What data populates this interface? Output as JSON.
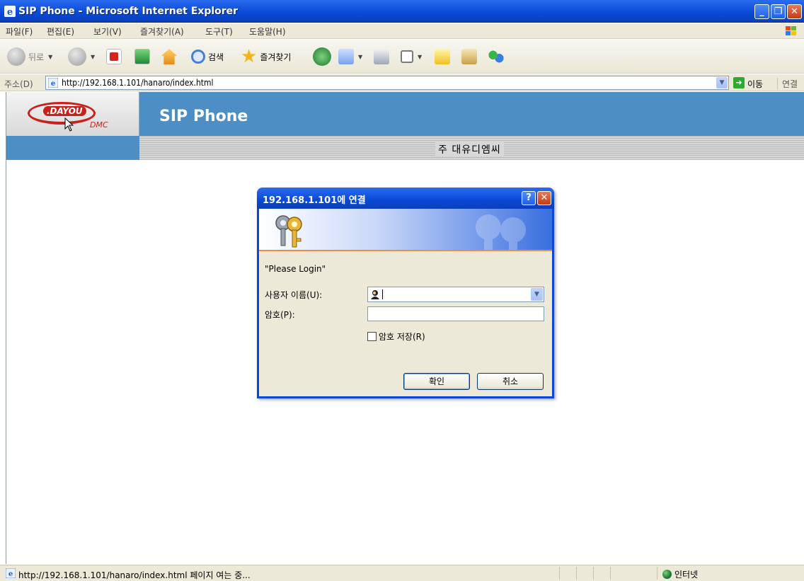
{
  "window": {
    "title": "SIP Phone - Microsoft Internet Explorer",
    "minimize_icon": "minimize-icon",
    "maximize_icon": "restore-icon",
    "close_icon": "close-icon"
  },
  "menu": {
    "items": [
      "파일(F)",
      "편집(E)",
      "보기(V)",
      "즐겨찾기(A)",
      "도구(T)",
      "도움말(H)"
    ]
  },
  "toolbar": {
    "back_label": "뒤로",
    "search_label": "검색",
    "favorites_label": "즐겨찾기"
  },
  "address": {
    "label": "주소(D)",
    "url": "http://192.168.1.101/hanaro/index.html",
    "go_label": "이동",
    "links_label": "연결"
  },
  "page": {
    "logo_text": ".DAYOU",
    "logo_sub": "DMC",
    "site_title": "SIP Phone",
    "company": "주 대유디엠씨",
    "brand_color": "#4d8fc4"
  },
  "dialog": {
    "title": "192.168.1.101에 연결",
    "message": "\"Please Login\"",
    "username_label": "사용자 이름(U):",
    "username_value": "",
    "password_label": "암호(P):",
    "password_value": "",
    "remember_label": "암호 저장(R)",
    "remember_checked": false,
    "ok_label": "확인",
    "cancel_label": "취소"
  },
  "status": {
    "message": "http://192.168.1.101/hanaro/index.html 페이지 여는 중...",
    "zone": "인터넷"
  }
}
